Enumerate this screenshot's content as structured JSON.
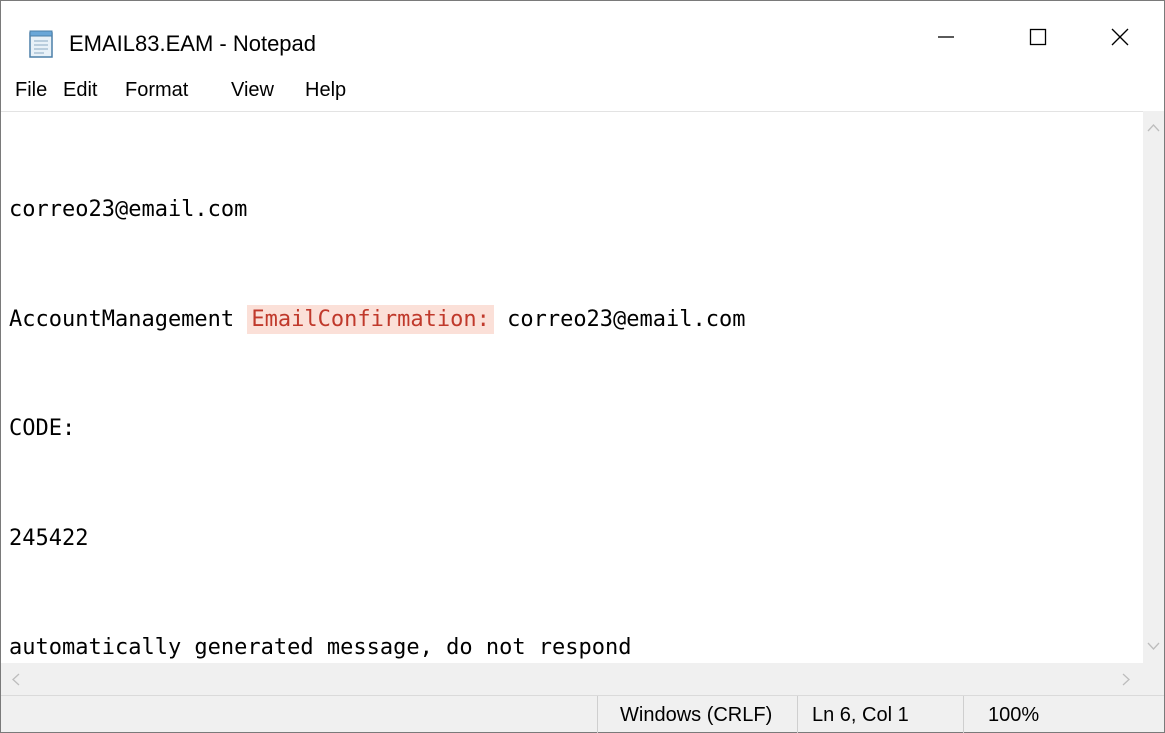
{
  "window": {
    "title": "EMAIL83.EAM - Notepad",
    "icons": [
      "notepad-icon",
      "minimize-icon",
      "maximize-icon",
      "close-icon"
    ]
  },
  "menu": {
    "file": "File",
    "edit": "Edit",
    "format": "Format",
    "view": "View",
    "help": "Help"
  },
  "content": {
    "line1": "correo23@email.com",
    "line2_prefix": "AccountManagement ",
    "line2_highlight": "EmailConfirmation:",
    "line2_suffix": " correo23@email.com",
    "line3": "CODE:",
    "line4": "245422",
    "line5": "automatically generated message, do not respond",
    "highlight_color": "#fbe0d8"
  },
  "status": {
    "line_ending": "Windows (CRLF)",
    "position": "Ln 6, Col 1",
    "zoom": "100%"
  }
}
